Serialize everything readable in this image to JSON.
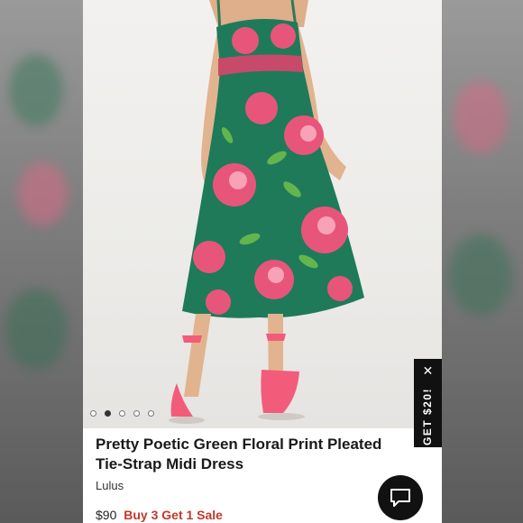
{
  "product": {
    "title": "Pretty Poetic Green Floral Print Pleated Tie-Strap Midi Dress",
    "brand": "Lulus",
    "price": "$90",
    "promo": "Buy 3 Get 1 Sale"
  },
  "carousel": {
    "dot_count": 5,
    "active_index": 1
  },
  "promo_tab": {
    "label": "GET $20!",
    "close_icon": "close-icon"
  },
  "chat": {
    "icon": "chat-icon"
  },
  "colors": {
    "dress_green": "#1f7a5a",
    "flower_pink": "#e8557a",
    "shoe_pink": "#f25c7a",
    "promo_red": "#c0392b",
    "tab_black": "#111111"
  }
}
